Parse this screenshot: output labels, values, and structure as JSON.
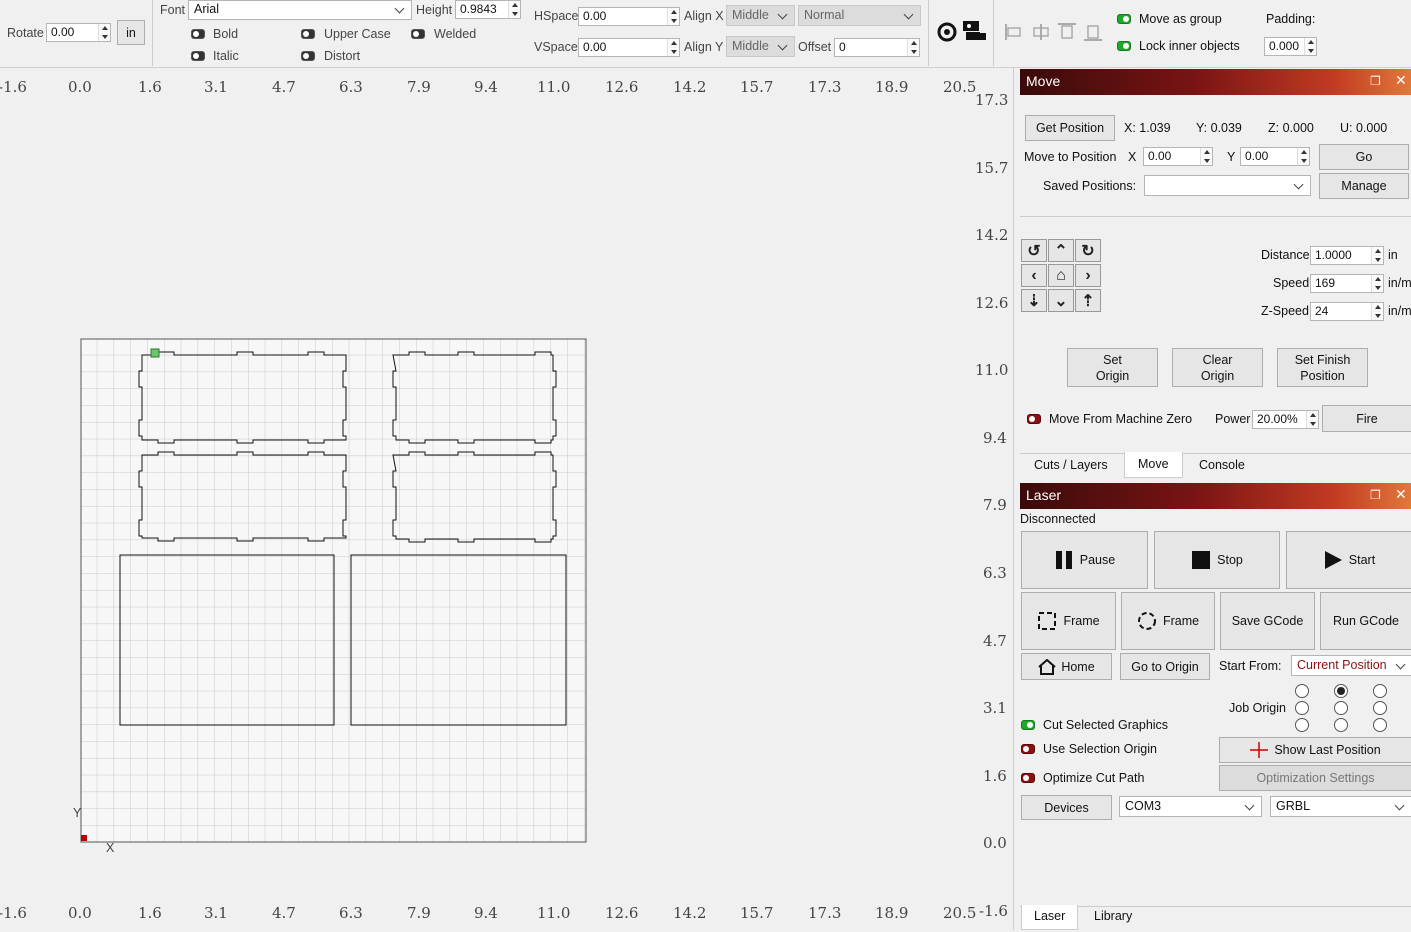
{
  "toolbar": {
    "rotate_label": "Rotate",
    "rotate_value": "0.00",
    "unit_button": "in",
    "font_label": "Font",
    "font_value": "Arial",
    "height_label": "Height",
    "height_value": "0.9843",
    "bold": "Bold",
    "italic": "Italic",
    "upper_case": "Upper Case",
    "distort": "Distort",
    "welded": "Welded",
    "hspace_label": "HSpace",
    "hspace_value": "0.00",
    "vspace_label": "VSpace",
    "vspace_value": "0.00",
    "alignx_label": "Align X",
    "alignx_value": "Middle",
    "aligny_label": "Align Y",
    "aligny_value": "Middle",
    "style_value": "Normal",
    "offset_label": "Offset",
    "offset_value": "0",
    "move_as_group": "Move as group",
    "lock_inner": "Lock inner objects",
    "padding_label": "Padding:",
    "padding_value": "0.000"
  },
  "ruler": {
    "top": [
      "-1.6",
      "0.0",
      "1.6",
      "3.1",
      "4.7",
      "6.3",
      "7.9",
      "9.4",
      "11.0",
      "12.6",
      "14.2",
      "15.7",
      "17.3",
      "18.9",
      "20.5"
    ],
    "bottom": [
      "-1.6",
      "0.0",
      "1.6",
      "3.1",
      "4.7",
      "6.3",
      "7.9",
      "9.4",
      "11.0",
      "12.6",
      "14.2",
      "15.7",
      "17.3",
      "18.9",
      "20.5"
    ],
    "right": [
      "17.3",
      "15.7",
      "14.2",
      "12.6",
      "11.0",
      "9.4",
      "7.9",
      "6.3",
      "4.7",
      "3.1",
      "1.6",
      "0.0",
      "-1.6"
    ],
    "axis_x": "X",
    "axis_y": "Y"
  },
  "move_panel": {
    "title": "Move",
    "get_position": "Get Position",
    "x": "X: 1.039",
    "y": "Y: 0.039",
    "z": "Z: 0.000",
    "u": "U: 0.000",
    "move_to_position": "Move to Position",
    "mx_label": "X",
    "mx_value": "0.00",
    "my_label": "Y",
    "my_value": "0.00",
    "go": "Go",
    "saved_positions": "Saved Positions:",
    "saved_value": "",
    "manage": "Manage",
    "distance_label": "Distance",
    "distance_value": "1.0000",
    "distance_unit": "in",
    "speed_label": "Speed",
    "speed_value": "169",
    "speed_unit": "in/m",
    "zspeed_label": "Z-Speed",
    "zspeed_value": "24",
    "zspeed_unit": "in/m",
    "set_origin": "Set Origin",
    "clear_origin": "Clear Origin",
    "set_finish": "Set Finish Position",
    "move_from_zero": "Move From Machine Zero",
    "power_label": "Power",
    "power_value": "20.00%",
    "fire": "Fire"
  },
  "tabs_top": [
    "Cuts / Layers",
    "Move",
    "Console"
  ],
  "laser_panel": {
    "title": "Laser",
    "status": "Disconnected",
    "pause": "Pause",
    "stop": "Stop",
    "start": "Start",
    "frame1": "Frame",
    "frame2": "Frame",
    "save_gcode": "Save GCode",
    "run_gcode": "Run GCode",
    "home": "Home",
    "go_to_origin": "Go to Origin",
    "start_from_label": "Start From:",
    "start_from_value": "Current Position",
    "job_origin": "Job Origin",
    "cut_selected": "Cut Selected Graphics",
    "use_selection_origin": "Use Selection Origin",
    "optimize_cut": "Optimize Cut Path",
    "show_last_position": "Show Last Position",
    "optimization_settings": "Optimization Settings",
    "devices": "Devices",
    "port": "COM3",
    "controller": "GRBL"
  },
  "tabs_bottom": [
    "Laser",
    "Library"
  ],
  "colors": {
    "accent_green": "#1fa82b",
    "toggle_red": "#8b1010",
    "header_dark": "#3a0a0a",
    "header_light": "#e1783c"
  }
}
